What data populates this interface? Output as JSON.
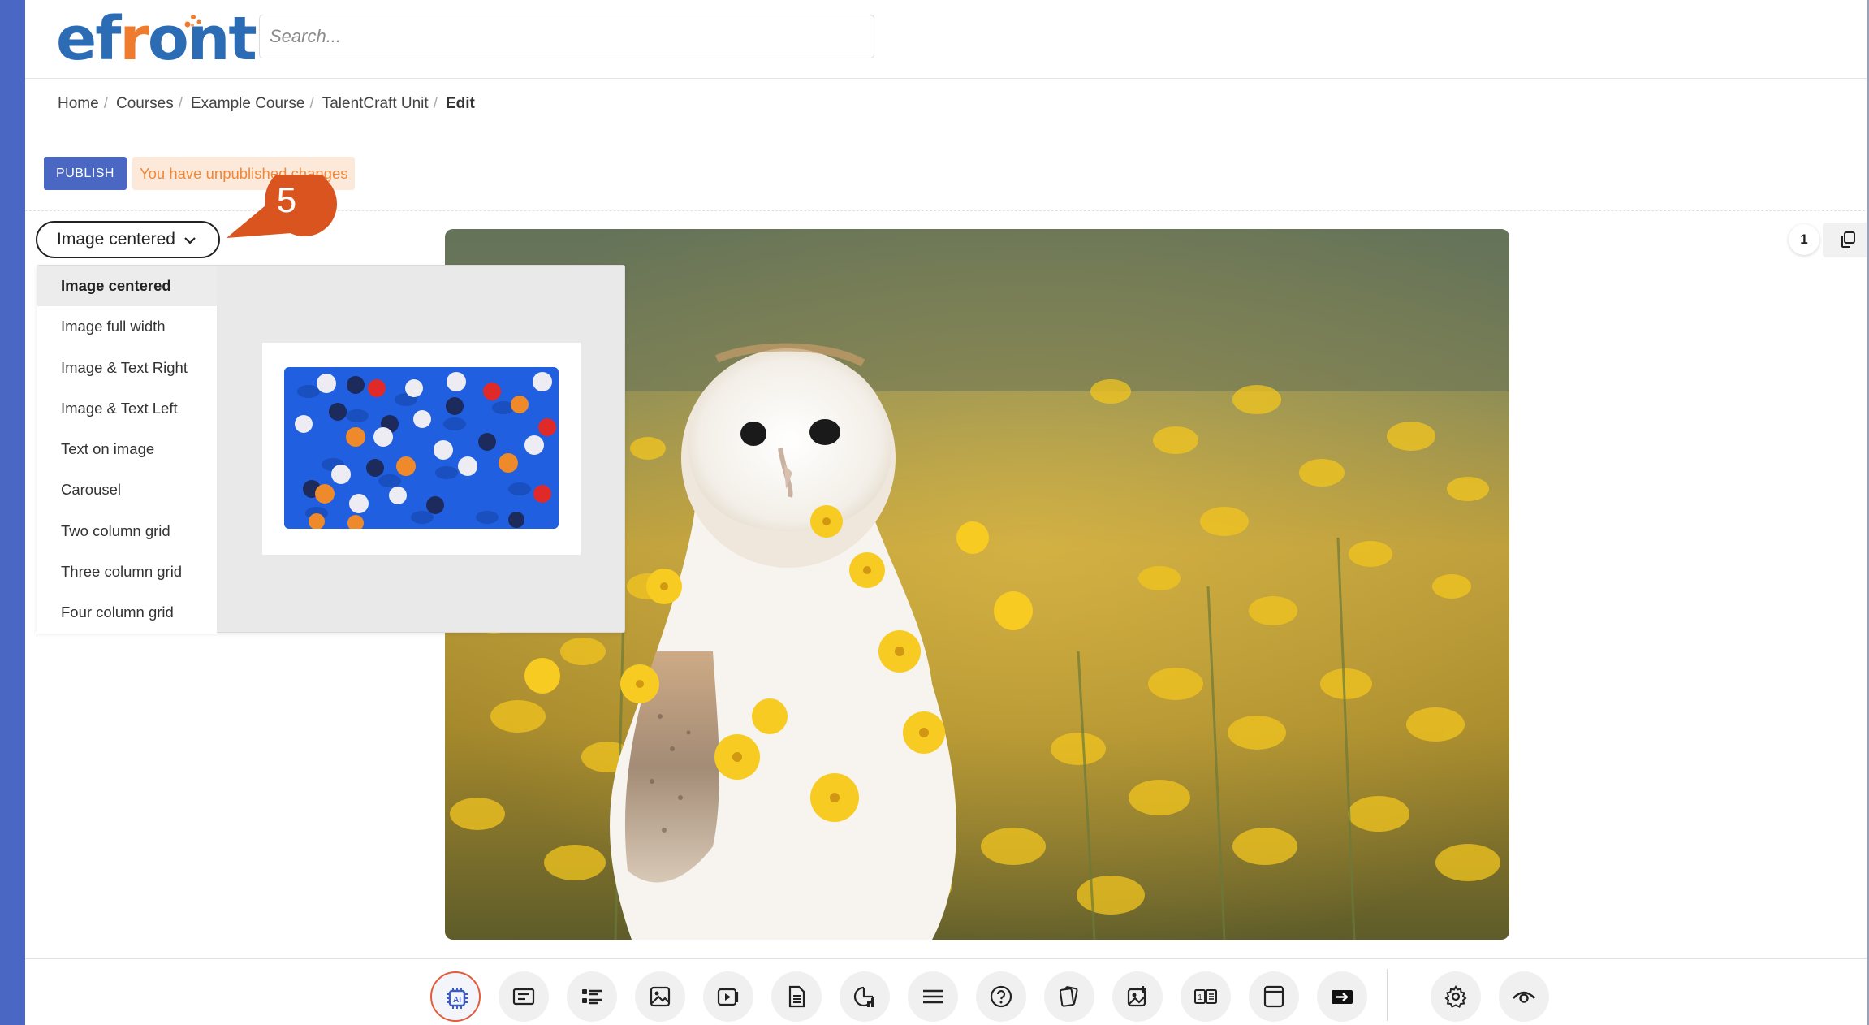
{
  "app": {
    "logo_text": "efront",
    "accent_color": "#4a67c4",
    "brand_blue": "#2b6cb5",
    "brand_orange": "#ee7b2e"
  },
  "search": {
    "placeholder": "Search..."
  },
  "breadcrumb": {
    "items": [
      "Home",
      "Courses",
      "Example Course",
      "TalentCraft Unit"
    ],
    "current": "Edit"
  },
  "publish": {
    "button_label": "PUBLISH",
    "status_text": "You have unpublished changes"
  },
  "callout": {
    "step_number": "5",
    "color": "#d9541e"
  },
  "layout_select": {
    "selected": "Image centered",
    "options": [
      "Image centered",
      "Image full width",
      "Image & Text Right",
      "Image & Text Left",
      "Text on image",
      "Carousel",
      "Two column grid",
      "Three column grid",
      "Four column grid"
    ]
  },
  "page_counter": {
    "current_page": "1"
  },
  "main_image": {
    "icon": "barn-owl-photo"
  },
  "toolbar": {
    "buttons": [
      {
        "icon": "ai-chip-icon"
      },
      {
        "icon": "text-block-icon"
      },
      {
        "icon": "list-icon"
      },
      {
        "icon": "image-icon"
      },
      {
        "icon": "video-icon"
      },
      {
        "icon": "document-icon"
      },
      {
        "icon": "chart-icon"
      },
      {
        "icon": "divider-lines-icon"
      },
      {
        "icon": "question-icon"
      },
      {
        "icon": "flashcards-icon"
      },
      {
        "icon": "image-gallery-icon"
      },
      {
        "icon": "number-text-icon"
      },
      {
        "icon": "embed-frame-icon"
      },
      {
        "icon": "slide-arrow-icon"
      },
      {
        "icon": "settings-gear-icon"
      },
      {
        "icon": "preview-eye-icon"
      }
    ]
  }
}
